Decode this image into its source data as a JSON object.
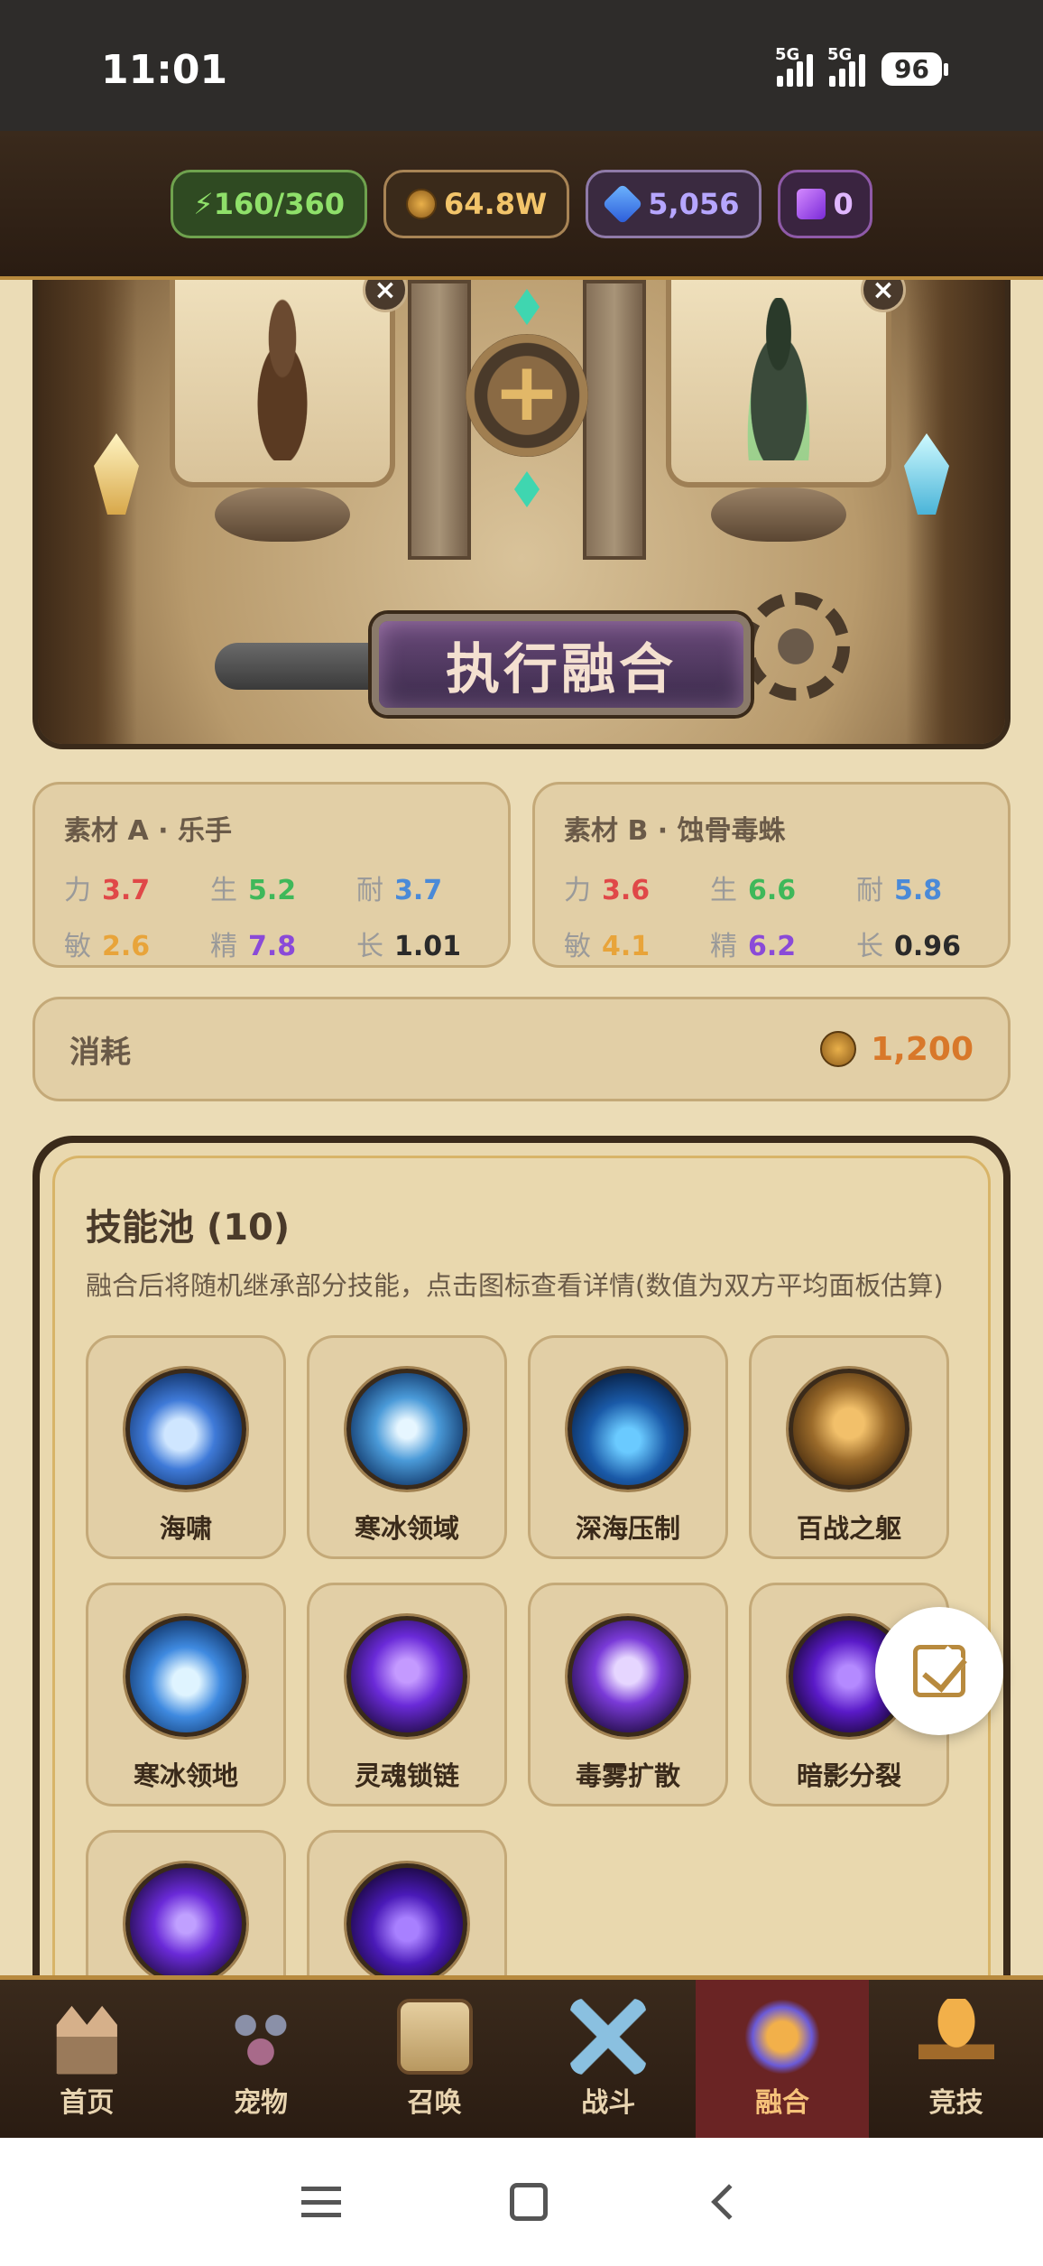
{
  "status_bar": {
    "time": "11:01",
    "network_1": "5G",
    "network_2": "5G",
    "battery": "96"
  },
  "resources": {
    "energy": "⚡160/360",
    "gold": "64.8W",
    "gems": "5,056",
    "crystals": "0",
    "colors": {
      "energy": "#8fe06a",
      "gold": "#f2c46a",
      "gems": "#b6a6ff"
    }
  },
  "fusion": {
    "button_label": "执行融合",
    "remove_glyph": "×",
    "plus_glyph": "+"
  },
  "materials": [
    {
      "title": "素材 A · 乐手",
      "stats": {
        "str_key": "力",
        "str": "3.7",
        "vit_key": "生",
        "vit": "5.2",
        "end_key": "耐",
        "end": "3.7",
        "agi_key": "敏",
        "agi": "2.6",
        "spi_key": "精",
        "spi": "7.8",
        "gro_key": "长",
        "gro": "1.01"
      }
    },
    {
      "title": "素材 B · 蚀骨毒蛛",
      "stats": {
        "str_key": "力",
        "str": "3.6",
        "vit_key": "生",
        "vit": "6.6",
        "end_key": "耐",
        "end": "5.8",
        "agi_key": "敏",
        "agi": "4.1",
        "spi_key": "精",
        "spi": "6.2",
        "gro_key": "长",
        "gro": "0.96"
      }
    }
  ],
  "cost": {
    "label": "消耗",
    "value": "1,200",
    "color": "#d8782a"
  },
  "skill_pool": {
    "title": "技能池 (10)",
    "description": "融合后将随机继承部分技能，点击图标查看详情(数值为双方平均面板估算)",
    "skills": [
      {
        "name": "海啸",
        "icon": "tsunami-icon"
      },
      {
        "name": "寒冰领域",
        "icon": "frost-domain-icon"
      },
      {
        "name": "深海压制",
        "icon": "deep-sea-icon"
      },
      {
        "name": "百战之躯",
        "icon": "veteran-body-icon"
      },
      {
        "name": "寒冰领地",
        "icon": "frost-territory-icon"
      },
      {
        "name": "灵魂锁链",
        "icon": "soul-chain-icon"
      },
      {
        "name": "毒雾扩散",
        "icon": "poison-fog-icon"
      },
      {
        "name": "暗影分裂",
        "icon": "shadow-split-icon"
      },
      {
        "name": "",
        "icon": "void-skull-icon"
      },
      {
        "name": "",
        "icon": "void-wraith-icon"
      }
    ]
  },
  "bottom_nav": {
    "active": "融合",
    "items": [
      {
        "label": "首页",
        "icon": "castle-icon"
      },
      {
        "label": "宠物",
        "icon": "paw-icon"
      },
      {
        "label": "召唤",
        "icon": "scroll-icon"
      },
      {
        "label": "战斗",
        "icon": "crossed-swords-icon"
      },
      {
        "label": "融合",
        "icon": "dragon-icon"
      },
      {
        "label": "竞技",
        "icon": "trophy-icon"
      }
    ]
  }
}
